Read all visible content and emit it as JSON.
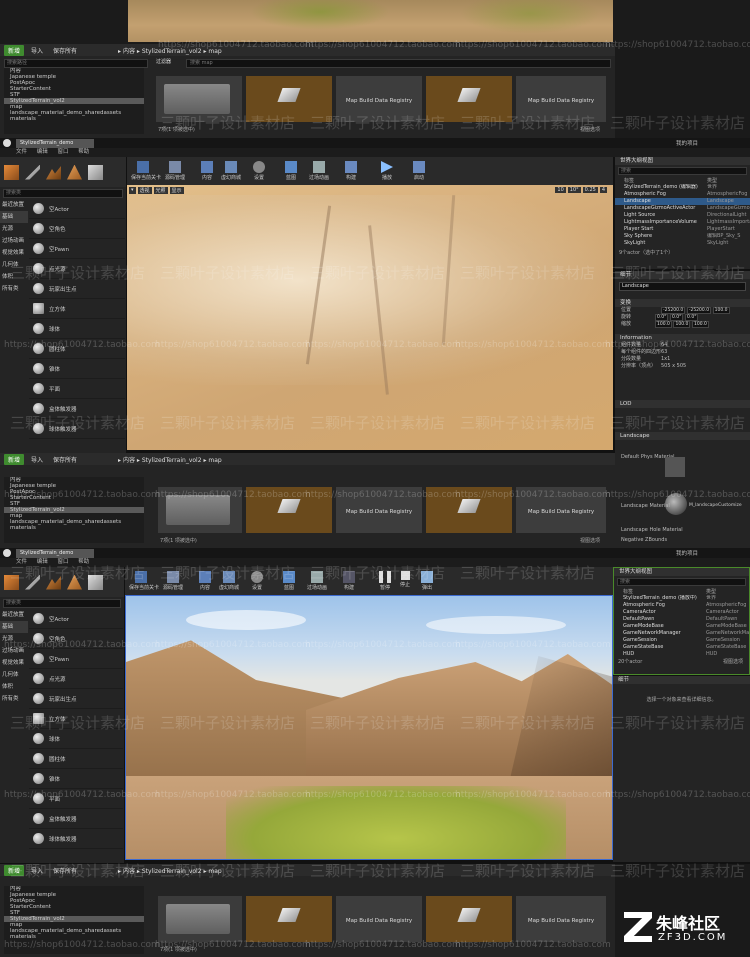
{
  "watermark": {
    "shop": "三颗叶子设计素材店",
    "url": "https://shop61004712.taobao.com"
  },
  "logo": {
    "title": "朱峰社区",
    "site": "ZF3D.COM"
  },
  "content_browser": {
    "add_new": "新增",
    "import": "导入",
    "save_all": "保存所有",
    "breadcrumb": [
      "内容",
      "StylizedTerrain_vol2",
      "map"
    ],
    "filter": "过滤器",
    "search_placeholder": "搜索 map",
    "search_paths": "搜索路径",
    "tree": [
      "内容",
      "Japanese temple",
      "PostApoc",
      "StarterContent",
      "STF",
      "StylizedTerrain_vol2",
      "map",
      "landscape_material_demo_sharedassets",
      "materials"
    ],
    "asset_registry": "Map Build Data Registry",
    "items_status": "7项(1 项被选中)",
    "view_options": "视图选项"
  },
  "editor": {
    "tab_title": "StylizedTerrain_demo",
    "top_right_tab": "我的项目",
    "menu": [
      "文件",
      "编辑",
      "窗口",
      "帮助"
    ],
    "toolbar": [
      "保存当前关卡",
      "源码管理",
      "内容",
      "虚幻商城",
      "设置",
      "蓝图",
      "过场动画",
      "构建",
      "播放",
      "启动"
    ],
    "toolbar_play2": [
      "保存当前关卡",
      "源码管理",
      "内容",
      "虚幻商城",
      "设置",
      "蓝图",
      "过场动画",
      "构建",
      "暂停",
      "停止",
      "弹出"
    ],
    "viewport_buttons": [
      "透视",
      "光照",
      "显示"
    ],
    "viewport_snap": [
      "10",
      "10°",
      "0.25",
      "4"
    ],
    "modes_search": "搜索类",
    "modes_categories": [
      "最近放置",
      "基础",
      "光源",
      "过场动画",
      "视觉效果",
      "几何体",
      "体积",
      "所有类"
    ],
    "modes_items": [
      "空Actor",
      "空角色",
      "空Pawn",
      "点光源",
      "玩家出生点",
      "立方体",
      "球体",
      "圆柱体",
      "锥体",
      "平面",
      "盒体触发器",
      "球体触发器"
    ]
  },
  "outliner": {
    "title": "世界大纲视图",
    "search": "搜索",
    "col_label": "标签",
    "col_type": "类型",
    "rows1": [
      {
        "label": "StylizedTerrain_demo (编辑器)",
        "type": "世界"
      },
      {
        "label": "Atmospheric Fog",
        "type": "AtmosphericFog"
      },
      {
        "label": "Landscape",
        "type": "Landscape"
      },
      {
        "label": "LandscapeGizmoActiveActor",
        "type": "LandscapeGizmo"
      },
      {
        "label": "Light Source",
        "type": "DirectionalLight"
      },
      {
        "label": "LightmassImportanceVolume",
        "type": "LightmassImportance"
      },
      {
        "label": "Player Start",
        "type": "PlayerStart"
      },
      {
        "label": "Sky Sphere",
        "type": "编辑BP_Sky_S"
      },
      {
        "label": "SkyLight",
        "type": "SkyLight"
      }
    ],
    "status1": "9个actor（选中了1个）",
    "rows2": [
      {
        "label": "StylizedTerrain_demo (播放中)",
        "type": "世界"
      },
      {
        "label": "Atmospheric Fog",
        "type": "AtmosphericFog"
      },
      {
        "label": "CameraActor",
        "type": "CameraActor"
      },
      {
        "label": "DefaultPawn",
        "type": "DefaultPawn"
      },
      {
        "label": "GameModeBase",
        "type": "GameModeBase"
      },
      {
        "label": "GameNetworkManager",
        "type": "GameNetworkMan"
      },
      {
        "label": "GameSession",
        "type": "GameSession"
      },
      {
        "label": "GameStateBase",
        "type": "GameStateBase"
      },
      {
        "label": "HUD",
        "type": "HUD"
      }
    ],
    "status2": "20个actor",
    "view_options": "视图选项"
  },
  "details": {
    "tab": "细节",
    "name": "Landscape",
    "transform": "变换",
    "location_label": "位置",
    "rotation_label": "旋转",
    "scale_label": "缩放",
    "location": [
      "-25200.0",
      "-25200.0",
      "100.0"
    ],
    "rotation": [
      "0.0°",
      "0.0°",
      "0.0°"
    ],
    "scale": [
      "100.0",
      "100.0",
      "100.0"
    ],
    "info_head": "Information",
    "info": [
      {
        "k": "组件数量",
        "v": "64"
      },
      {
        "k": "每个组件的四边形",
        "v": "63"
      },
      {
        "k": "分段数量",
        "v": "1x1"
      },
      {
        "k": "分辨率（顶点）",
        "v": "505 x 505"
      }
    ],
    "lod_head": "LOD",
    "landscape_head": "Landscape",
    "material_label": "Landscape Material",
    "material_value": "M_landscapeCustomize",
    "default_phys": "Default Phys Material",
    "hole_material": "Landscape Hole Material",
    "negative_z": "Negative ZBounds",
    "empty_hint": "选择一个对象来查看详细信息。"
  }
}
